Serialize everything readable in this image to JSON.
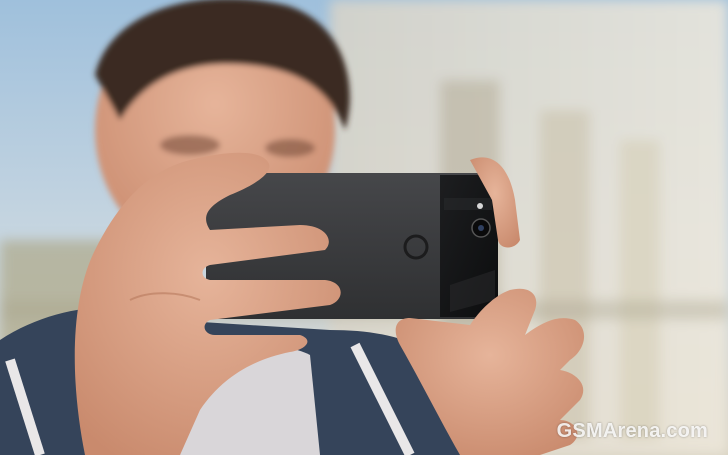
{
  "photo": {
    "subject": "man-holding-smartphone",
    "phone_color": "#3a3b3d",
    "glass_color": "#121314",
    "sky_color": "#b9cfe0",
    "watermark": "GSMArena.com"
  }
}
